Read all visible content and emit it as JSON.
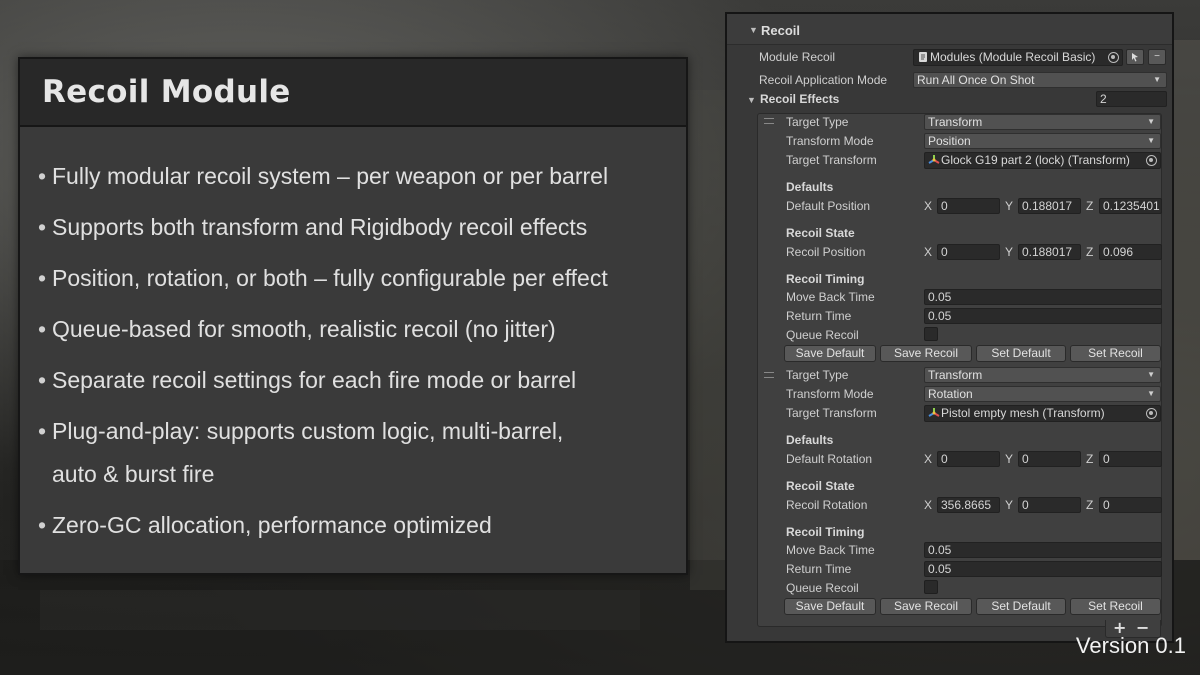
{
  "info_panel": {
    "title": "Recoil Module",
    "bullets": [
      "Fully modular recoil system – per weapon or per barrel",
      "Supports both transform and Rigidbody recoil effects",
      "Position, rotation, or both – fully configurable per effect",
      "Queue-based for smooth, realistic recoil (no jitter)",
      "Separate recoil settings for each fire mode or barrel",
      "Plug-and-play: supports custom logic, multi-barrel,\nauto & burst fire",
      "Zero-GC allocation, performance optimized"
    ]
  },
  "inspector": {
    "component_title": "Recoil",
    "module_recoil_label": "Module Recoil",
    "module_recoil_value": "Modules (Module Recoil Basic)",
    "application_mode_label": "Recoil Application Mode",
    "application_mode_value": "Run All Once On Shot",
    "effects_label": "Recoil Effects",
    "effects_count": "2",
    "effects": [
      {
        "target_type_label": "Target Type",
        "target_type": "Transform",
        "transform_mode_label": "Transform Mode",
        "transform_mode": "Position",
        "target_transform_label": "Target Transform",
        "target_transform": "Glock G19 part 2 (lock) (Transform)",
        "defaults_header": "Defaults",
        "default_label": "Default Position",
        "default_x": "0",
        "default_y": "0.188017",
        "default_z": "0.1235401",
        "state_header": "Recoil State",
        "state_label": "Recoil Position",
        "state_x": "0",
        "state_y": "0.188017",
        "state_z": "0.096",
        "timing_header": "Recoil Timing",
        "move_back_label": "Move Back Time",
        "move_back": "0.05",
        "return_label": "Return Time",
        "return_time": "0.05",
        "queue_label": "Queue Recoil"
      },
      {
        "target_type_label": "Target Type",
        "target_type": "Transform",
        "transform_mode_label": "Transform Mode",
        "transform_mode": "Rotation",
        "target_transform_label": "Target Transform",
        "target_transform": "Pistol empty mesh (Transform)",
        "defaults_header": "Defaults",
        "default_label": "Default Rotation",
        "default_x": "0",
        "default_y": "0",
        "default_z": "0",
        "state_header": "Recoil State",
        "state_label": "Recoil Rotation",
        "state_x": "356.8665",
        "state_y": "0",
        "state_z": "0",
        "timing_header": "Recoil Timing",
        "move_back_label": "Move Back Time",
        "move_back": "0.05",
        "return_label": "Return Time",
        "return_time": "0.05",
        "queue_label": "Queue Recoil"
      }
    ],
    "axis_labels": {
      "x": "X",
      "y": "Y",
      "z": "Z"
    },
    "buttons": {
      "save_default": "Save Default",
      "save_recoil": "Save Recoil",
      "set_default": "Set Default",
      "set_recoil": "Set Recoil"
    },
    "list_controls": {
      "add": "+",
      "remove": "−"
    },
    "small_minus": "−"
  },
  "version": "Version 0.1",
  "icons": [
    "dropdown-arrow-icon",
    "object-picker-icon",
    "transform-icon",
    "script-icon",
    "foldout-arrow-icon",
    "drag-handle-icon"
  ]
}
